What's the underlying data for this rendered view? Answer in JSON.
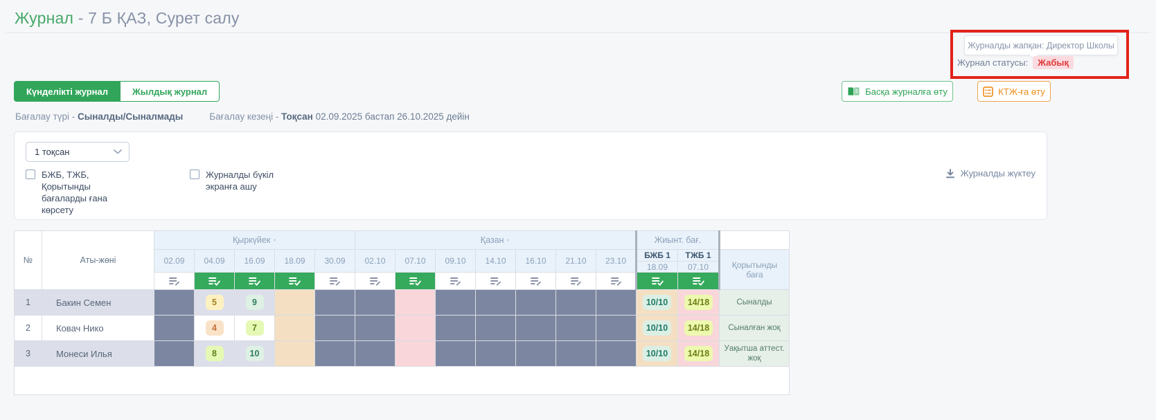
{
  "header": {
    "title_main": "Журнал",
    "title_rest": " - 7 Б ҚАЗ, Сурет салу"
  },
  "annotation": {
    "tooltip": "Журналды жапқан: Директор Школы",
    "status_label": "Журнал статусы:",
    "status_value": "Жабық"
  },
  "tabs": {
    "daily": "Күнделікті журнал",
    "yearly": "Жылдық журнал"
  },
  "actions": {
    "other_journal": "Басқа журналға өту",
    "ktzh": "КТЖ-ға өту",
    "download": "Журналды жүктеу"
  },
  "meta": {
    "type_label": "Бағалау түрі - ",
    "type_value": "Сыналды/Сыналмады",
    "period_label": "Бағалау кезеңі - ",
    "period_bold": "Тоқсан",
    "period_rest": " 02.09.2025 бастап 26.10.2025 дейін"
  },
  "filters": {
    "quarter": "1 тоқсан",
    "only_summary": "БЖБ, ТЖБ, Қорытынды бағаларды ғана көрсету",
    "fullscreen": "Журналды бүкіл экранға ашу"
  },
  "icons": {
    "month_caret": "‣"
  },
  "table": {
    "num_header": "№",
    "name_header": "Аты-жөні",
    "month1": "Қыркүйек",
    "month2": "Қазан",
    "dates": [
      "02.09",
      "04.09",
      "16.09",
      "18.09",
      "30.09",
      "02.10",
      "07.10",
      "09.10",
      "14.10",
      "16.10",
      "21.10",
      "23.10"
    ],
    "summary_header": "Жиынт. бағ.",
    "bzb_name": "БЖБ 1",
    "bzb_date": "18.09",
    "tzb_name": "ТЖБ 1",
    "tzb_date": "07.10",
    "final_header": "Қорытынды баға",
    "rows": [
      {
        "num": "1",
        "name": "Бакин Семен",
        "g1": "5",
        "g2": "9",
        "bzb": "10/10",
        "tzb": "14/18",
        "final": "Сыналды"
      },
      {
        "num": "2",
        "name": "Ковач Нико",
        "g1": "4",
        "g2": "7",
        "bzb": "10/10",
        "tzb": "14/18",
        "final": "Сыналған жоқ"
      },
      {
        "num": "3",
        "name": "Монеси Илья",
        "g1": "8",
        "g2": "10",
        "bzb": "10/10",
        "tzb": "14/18",
        "final": "Уақытша аттест. жоқ"
      }
    ]
  },
  "colors": {
    "accent_green": "#31a65a",
    "accent_orange": "#ee8b17",
    "annotation_red": "#e2231a",
    "status_red": "#e03a3a",
    "dark_cell": "#7d86a1",
    "peach_cell": "#f4dfc3",
    "pink_cell": "#f8d6da",
    "header_blue": "#e9f2fb"
  }
}
